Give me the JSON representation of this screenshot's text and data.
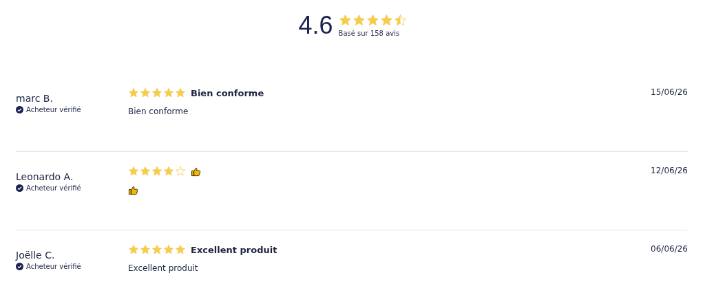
{
  "summary": {
    "score": "4.6",
    "stars": 4.5,
    "caption": "Basé sur 158 avis"
  },
  "reviews": [
    {
      "author": "marc B.",
      "badge": "Acheteur vérifié",
      "stars": 5,
      "title": "Bien conforme",
      "body": "Bien conforme",
      "date": "15/06/26"
    },
    {
      "author": "Leonardo A.",
      "badge": "Acheteur vérifié",
      "stars": 4,
      "title_thumb": true,
      "body_thumb": true,
      "date": "12/06/26"
    },
    {
      "author": "Joëlle C.",
      "badge": "Acheteur vérifié",
      "stars": 5,
      "title": "Excellent produit",
      "body": "Excellent produit",
      "date": "06/06/26"
    }
  ]
}
